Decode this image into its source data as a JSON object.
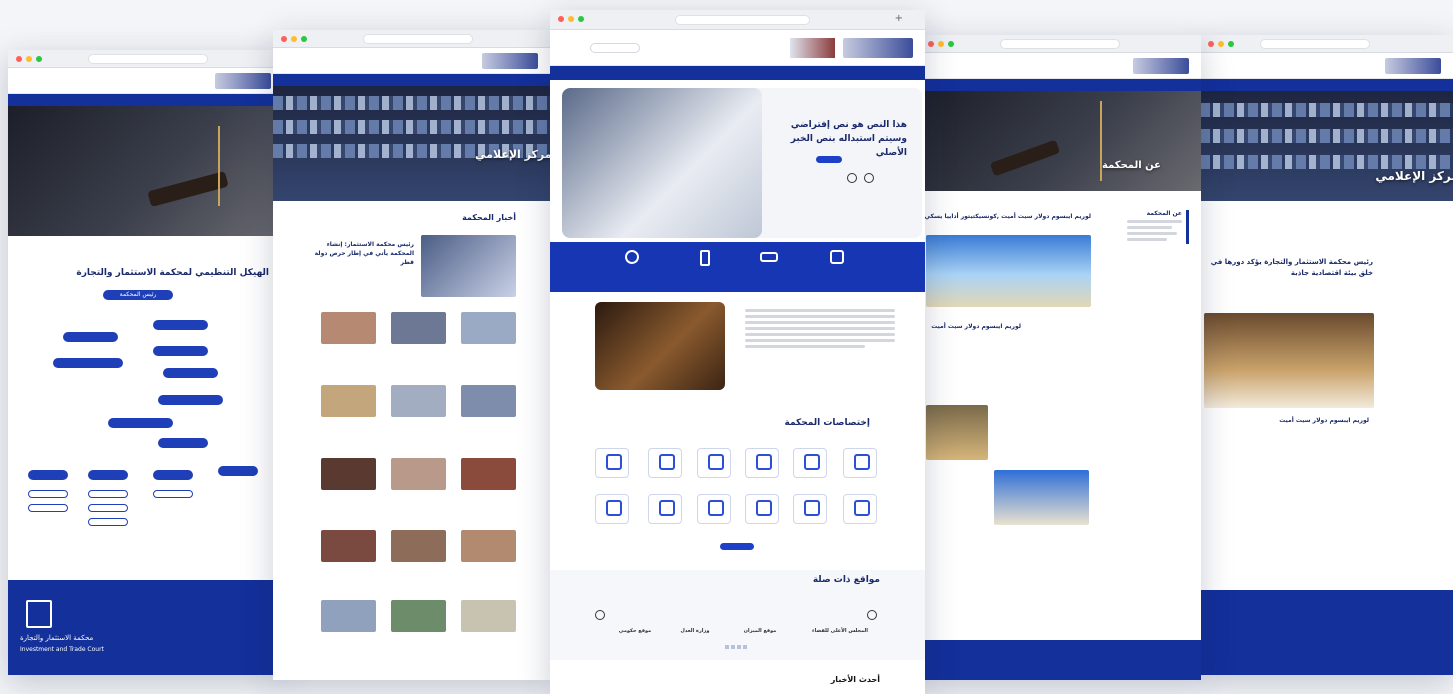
{
  "main": {
    "hero_heading": "هذا النص هو نص إفتراضي وسيتم استبداله بنص الخبر الأصلي",
    "specializations_title": "إختصاصات المحكمة",
    "related_sites_title": "مواقع ذات صلة",
    "latest_news_title": "أحدث الأخبار",
    "related_sites": [
      "المجلس الأعلى للقضاء",
      "موقع الميزان",
      "وزارة العدل",
      "موقع حكومي"
    ]
  },
  "left_card": {
    "org_title": "الهيكل التنظيمي لمحكمة الاستثمار والتجارة",
    "org_root": "رئيس المحكمة",
    "court_name": "محكمة الاستثمار والتجارة",
    "court_name_en": "Investment and Trade Court"
  },
  "left2_card": {
    "hero_title": "المركز الإعلامي",
    "news_title": "أخبار المحكمة",
    "lead_headline": "رئيس محكمة الاستثمار: إنشاء المحكمة يأتي في إطار حرص دولة قطر"
  },
  "right_card": {
    "hero_title": "عن المحكمة",
    "headline": "لوريم ايبسوم دولار سيت أميت ,كونسيكتيتور أداييا يسكي",
    "side_title": "عن المحكمة",
    "sub_heading": "لوريم ايبسوم دولار سيت أميت"
  },
  "right2_card": {
    "hero_title": "المركز الإعلامي",
    "headline": "رئيس محكمة الاستثمار والتجارة يؤكد دورها في خلق بيئة اقتصادية جاذبة",
    "sub_heading": "لوريم ايبسوم دولار سيت أميت"
  }
}
